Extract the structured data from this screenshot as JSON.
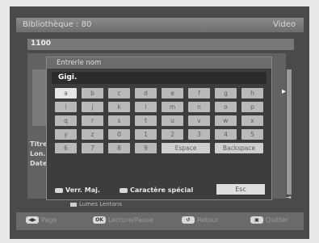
{
  "header": {
    "title": "Bibliothèque : 80",
    "right_label": "Video"
  },
  "sub_header": {
    "label": "1100"
  },
  "side_info": {
    "lines": [
      "Titre",
      "Lon.",
      "Date"
    ]
  },
  "legend": {
    "text": "Lumes  Lentons"
  },
  "bottom_bar": {
    "items": [
      {
        "key": "◀▶",
        "label": "Page"
      },
      {
        "key": "OK",
        "label": "Lecture/Pause"
      },
      {
        "key": "↺",
        "label": "Retour"
      },
      {
        "key": "▣",
        "label": "Quitter"
      }
    ]
  },
  "dialog": {
    "title": "Entrerle nom",
    "entry_value": "Gigi.",
    "keys": [
      [
        "a",
        "b",
        "c",
        "d",
        "e",
        "f",
        "g",
        "h"
      ],
      [
        "i",
        "j",
        "k",
        "l",
        "m",
        "n",
        "o",
        "p"
      ],
      [
        "q",
        "r",
        "s",
        "t",
        "u",
        "v",
        "w",
        "x"
      ],
      [
        "y",
        "z",
        "0",
        "1",
        "2",
        "3",
        "4",
        "5"
      ],
      [
        "6",
        "7",
        "8",
        "9",
        "Espace",
        "Backspace"
      ]
    ],
    "footer": {
      "caps_label": "Verr. Maj.",
      "special_label": "Caractère spécial",
      "esc_label": "Esc"
    }
  },
  "colors": {
    "screen_bg": "#4a4a4a",
    "dialog_bg": "#3d3d3d",
    "key_bg": "#b9b9b9"
  }
}
